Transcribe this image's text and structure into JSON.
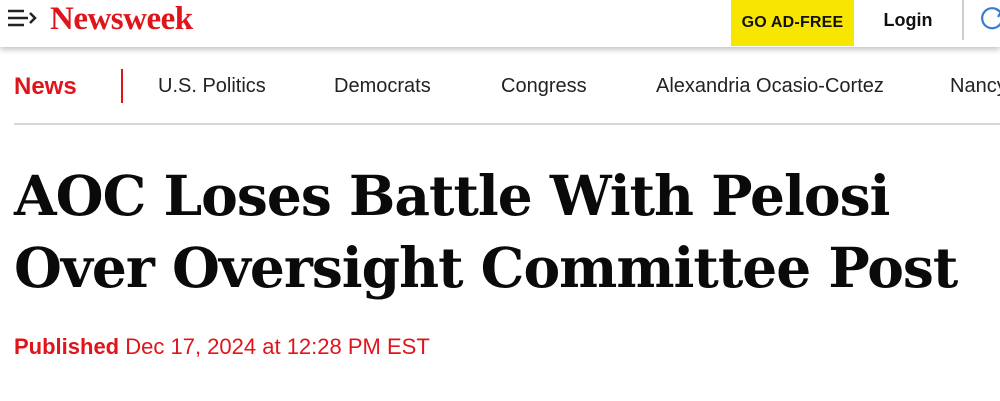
{
  "header": {
    "logo": "Newsweek",
    "ad_free_label": "GO AD-FREE",
    "login_label": "Login"
  },
  "nav": {
    "section": "News",
    "links": [
      "U.S. Politics",
      "Democrats",
      "Congress",
      "Alexandria Ocasio-Cortez",
      "Nancy"
    ]
  },
  "article": {
    "headline_line1": "AOC Loses Battle With Pelosi",
    "headline_line2": "Over Oversight Committee Post",
    "published_label": "Published",
    "published_date": "Dec 17, 2024 at 12:28 PM EST"
  },
  "icons": {
    "menu": "menu-icon",
    "refresh": "refresh-icon"
  },
  "colors": {
    "brand_red": "#e0141b",
    "ad_free_yellow": "#f6e600"
  }
}
